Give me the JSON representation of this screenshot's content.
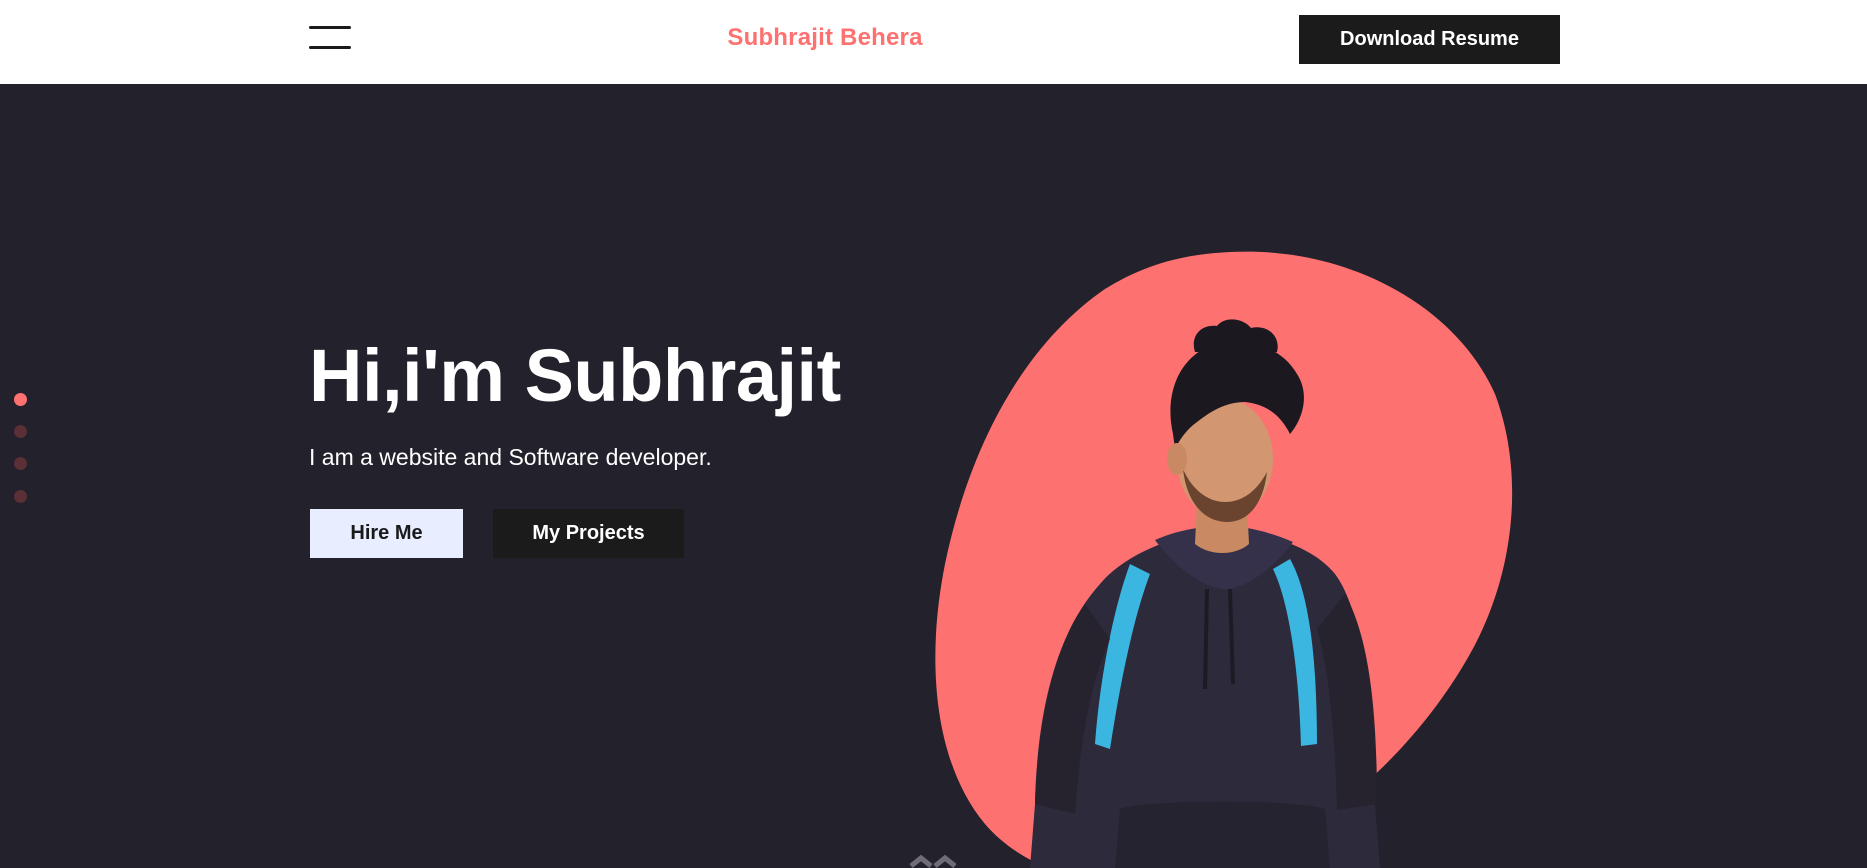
{
  "header": {
    "menu_icon": "hamburger-menu-icon",
    "brand_name": "Subhrajit Behera",
    "resume_button_label": "Download Resume"
  },
  "hero": {
    "headline": "Hi,i'm Subhrajit",
    "subline": "I am a website and Software developer.",
    "hire_button_label": "Hire Me",
    "projects_button_label": "My Projects",
    "portrait_icon": "profile-photo",
    "scroll_icon": "chevron-down-icon"
  },
  "slide_nav": {
    "count": 4,
    "active_index": 0
  },
  "colors": {
    "accent": "#fe7171",
    "background_dark": "#23212b",
    "header_bg": "#ffffff",
    "button_dark": "#1b1b1b",
    "button_light": "#e8eeff",
    "text_light": "#ffffff"
  }
}
